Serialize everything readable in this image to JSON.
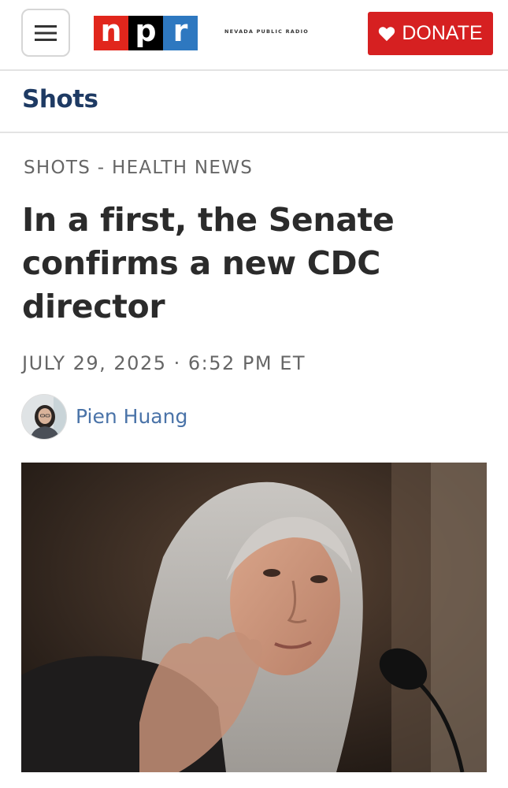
{
  "header": {
    "menu_icon": "hamburger-menu-icon",
    "logo_letters": [
      "n",
      "p",
      "r"
    ],
    "logo_colors": [
      "#e1261c",
      "#000000",
      "#2e78c0"
    ],
    "station_name": "NEVADA PUBLIC RADIO",
    "donate_label": "DONATE",
    "donate_icon": "heart-icon",
    "donate_color": "#d62021"
  },
  "section": {
    "title": "Shots"
  },
  "article": {
    "kicker": "SHOTS - HEALTH NEWS",
    "headline": "In a first, the Senate confirms a new CDC director",
    "dateline": "JULY 29, 2025 · 6:52 PM ET",
    "author": "Pien Huang"
  }
}
